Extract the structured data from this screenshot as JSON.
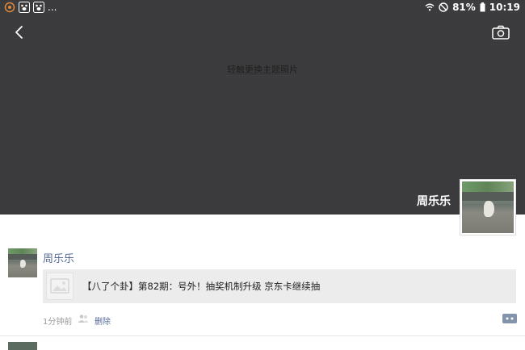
{
  "status_bar": {
    "left_icons": [
      "notification-icon",
      "paw-icon",
      "paw-icon"
    ],
    "more": "...",
    "battery": "81%",
    "time": "10:19"
  },
  "cover": {
    "hint": "轻触更换主题照片",
    "username": "周乐乐"
  },
  "post": {
    "author": "周乐乐",
    "share_title": "【八了个卦】第82期：号外！抽奖机制升级 京东卡继续抽",
    "time_ago": "1分钟前",
    "delete_label": "删除"
  },
  "colors": {
    "link": "#576b95",
    "cover_bg": "#3a3a3c"
  }
}
